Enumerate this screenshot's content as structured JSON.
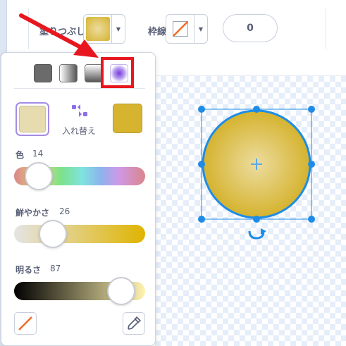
{
  "toolbar": {
    "fill_label": "塗りつぶし",
    "outline_label": "枠線",
    "outline_width": "0"
  },
  "colors": {
    "fill_gradient_inner": "#ecdc9f",
    "fill_gradient_outer": "#d5b32e",
    "primary_swatch": "#e6dcb0",
    "secondary_swatch": "#d6b42f",
    "selection_blue": "#1e8ce6",
    "annotation_red": "#e8161f",
    "swap_icon": "#8e6ee6"
  },
  "color_picker": {
    "modes": [
      {
        "name": "solid",
        "icon": "solid-fill-icon"
      },
      {
        "name": "horizontal-gradient",
        "icon": "horizontal-gradient-icon"
      },
      {
        "name": "vertical-gradient",
        "icon": "vertical-gradient-icon"
      },
      {
        "name": "radial-gradient",
        "icon": "radial-gradient-icon",
        "selected": true
      }
    ],
    "swap_label": "入れ替え",
    "sliders": [
      {
        "label": "色",
        "value": "14",
        "level_percent": 14
      },
      {
        "label": "鮮やかさ",
        "value": "26",
        "level_percent": 26
      },
      {
        "label": "明るさ",
        "value": "87",
        "level_percent": 87
      }
    ]
  }
}
